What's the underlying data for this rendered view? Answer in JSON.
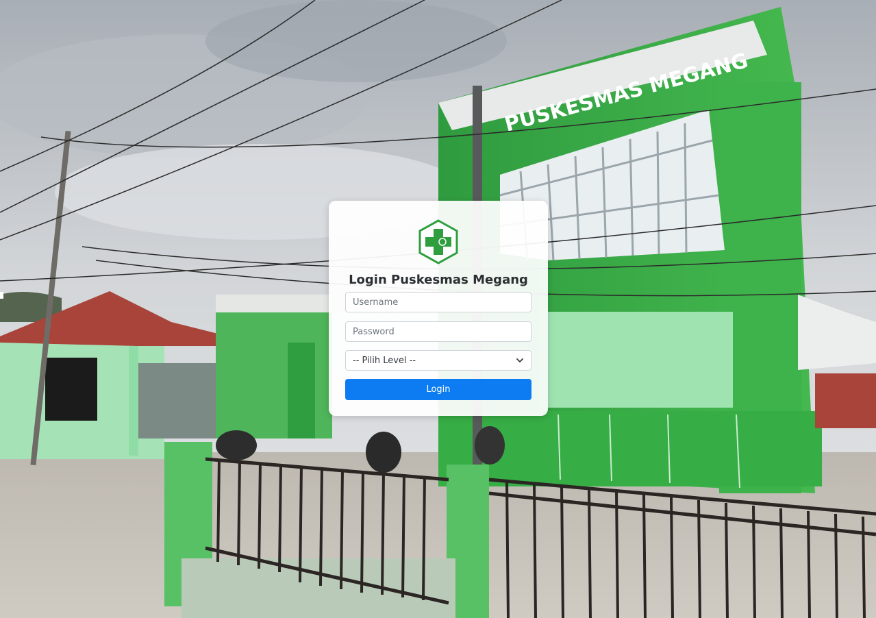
{
  "login": {
    "title": "Login Puskesmas Megang",
    "username_placeholder": "Username",
    "password_placeholder": "Password",
    "level_selected": "-- Pilih Level --",
    "level_options": [
      "-- Pilih Level --"
    ],
    "submit_label": "Login"
  },
  "background": {
    "building_sign": "PUSKESMAS MEGANG",
    "description_colors": {
      "sky": "#c9cdd1",
      "building_green": "#3fae4a",
      "light_green_wall": "#9fe0b0",
      "roof_red": "#a9443a"
    }
  },
  "colors": {
    "accent": "#0d7cf2",
    "logo_green": "#2e9e3f"
  },
  "icons": {
    "logo": "puskesmas-logo-icon",
    "select": "chevron-down-icon"
  }
}
